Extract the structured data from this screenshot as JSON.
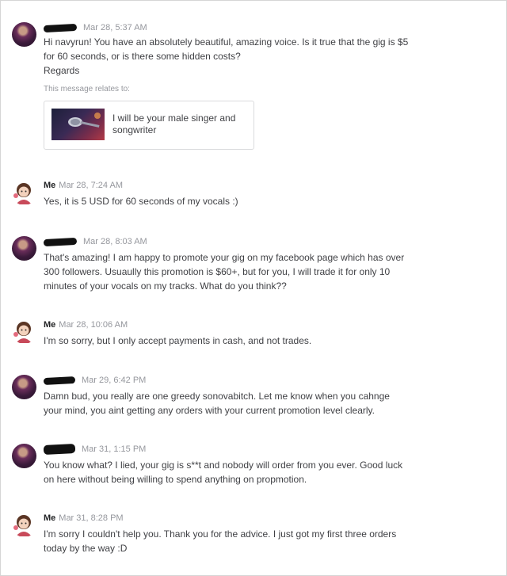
{
  "conversation": {
    "messages": [
      {
        "sender": "",
        "time": "Mar 28, 5:37 AM",
        "lines": [
          "Hi navyrun! You have an absolutely beautiful, amazing voice. Is it true that the gig is $5",
          "for 60 seconds, or is there some hidden costs?",
          "Regards"
        ],
        "relates_label": "This message relates to:",
        "gig": {
          "title_lines": [
            "I will be your male singer and",
            "songwriter"
          ]
        }
      },
      {
        "sender": "Me",
        "time": "Mar 28, 7:24 AM",
        "lines": [
          "Yes, it is 5 USD for 60 seconds of my vocals :)"
        ]
      },
      {
        "sender": "",
        "time": "Mar 28, 8:03 AM",
        "lines": [
          "That's amazing! I am happy to promote your gig on my facebook page which has over",
          "300 followers. Usuaully this promotion is $60+, but for you, I will trade it for only 10",
          "minutes of your vocals on my tracks. What do you think??"
        ]
      },
      {
        "sender": "Me",
        "time": "Mar 28, 10:06 AM",
        "lines": [
          "I'm so sorry, but I only accept payments in cash, and not trades."
        ]
      },
      {
        "sender": "",
        "time": "Mar 29, 6:42 PM",
        "lines": [
          "Damn bud, you really are one greedy sonovabitch. Let me know when you cahnge",
          "your mind, you aint getting any orders with your current promotion level clearly."
        ]
      },
      {
        "sender": "",
        "time": "Mar 31, 1:15 PM",
        "lines": [
          "You know what? I lied, your gig is s**t and nobody will order from you ever. Good luck",
          "on here without being willing to spend anything on propmotion."
        ]
      },
      {
        "sender": "Me",
        "time": "Mar 31, 8:28 PM",
        "lines": [
          "I'm sorry I couldn't help you. Thank you for the advice. I just got my first three orders",
          "today by the way :D"
        ]
      }
    ]
  }
}
